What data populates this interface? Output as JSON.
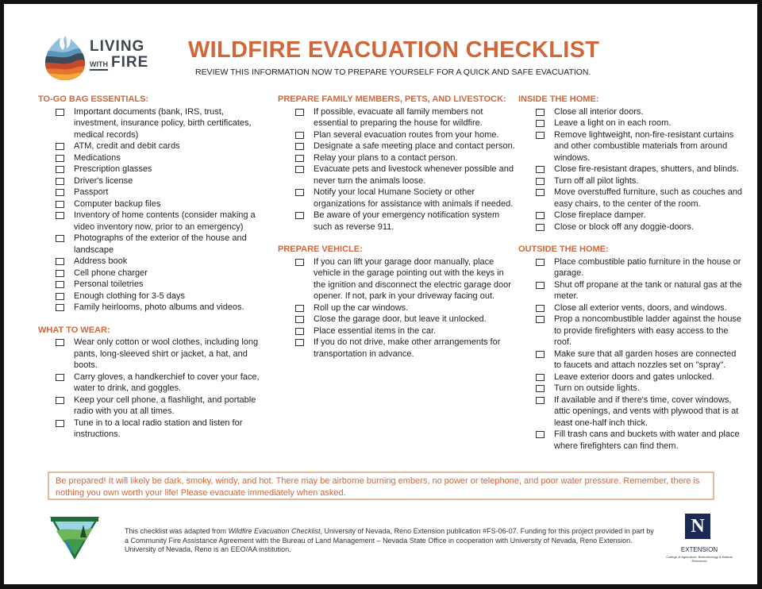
{
  "logo": {
    "line1": "LIVING",
    "with": "WITH",
    "fire": "FIRE"
  },
  "title": "WILDFIRE EVACUATION CHECKLIST",
  "subtitle": "REVIEW THIS INFORMATION NOW TO PREPARE YOURSELF FOR A QUICK AND SAFE EVACUATION.",
  "colors": {
    "accent": "#d0673a",
    "text": "#222222",
    "callout_border": "#e8b89a",
    "unr_navy": "#1b2a55"
  },
  "sections": {
    "to_go_bag": {
      "heading": "TO-GO BAG ESSENTIALS:",
      "items": [
        "Important documents (bank, IRS, trust, investment, insurance policy, birth certificates, medical records)",
        "ATM, credit and debit cards",
        "Medications",
        "Prescription glasses",
        "Driver's license",
        "Passport",
        "Computer backup files",
        "Inventory of home contents (consider making a video inventory now, prior to an emergency)",
        "Photographs of the exterior of the house and landscape",
        "Address book",
        "Cell phone charger",
        "Personal toiletries",
        "Enough clothing for 3-5 days",
        "Family heirlooms, photo albums and videos."
      ]
    },
    "what_to_wear": {
      "heading": "WHAT TO WEAR:",
      "items": [
        "Wear only cotton or wool clothes, including long pants, long-sleeved shirt or jacket, a hat, and boots.",
        "Carry gloves, a handkerchief to cover your face, water to drink, and goggles.",
        "Keep your cell phone, a flashlight, and portable radio with you at all times.",
        "Tune in to a local radio station and listen for instructions."
      ]
    },
    "family_pets": {
      "heading": "PREPARE FAMILY MEMBERS, PETS, AND LIVESTOCK:",
      "items": [
        "If possible, evacuate all family members not essential to preparing the house for wildfire.",
        "Plan several evacuation routes from your home.",
        "Designate a safe meeting place and contact person.",
        "Relay your plans to a contact person.",
        "Evacuate pets and livestock whenever possible and never turn the animals loose.",
        "Notify your local Humane Society or other organizations for assistance with animals if needed.",
        "Be aware of your emergency notification system such as reverse 911."
      ]
    },
    "vehicle": {
      "heading": "PREPARE VEHICLE:",
      "items": [
        "If you can lift your garage door manually, place vehicle in the garage pointing out with the keys in the ignition and disconnect the electric garage door opener. If not, park in your driveway facing out.",
        "Roll up the car windows.",
        "Close the garage door, but leave it unlocked.",
        "Place essential items in the car.",
        "If you do not drive, make other arrangements for transportation in advance."
      ]
    },
    "inside_home": {
      "heading": "INSIDE THE HOME:",
      "items": [
        "Close all interior doors.",
        "Leave a light on in each room.",
        "Remove lightweight, non-fire-resistant curtains and other combustible materials from around windows.",
        "Close fire-resistant drapes, shutters, and blinds.",
        "Turn off all pilot lights.",
        "Move overstuffed furniture, such as couches and easy chairs, to the center of the room.",
        "Close fireplace damper.",
        "Close or block off any doggie-doors."
      ]
    },
    "outside_home": {
      "heading": "OUTSIDE THE HOME:",
      "items": [
        "Place combustible patio furniture in the house or garage.",
        "Shut off propane at the tank or natural gas at the meter.",
        "Close all exterior vents, doors, and windows.",
        "Prop a noncombustible ladder against the house to provide firefighters with easy access to the roof.",
        "Make sure that all garden hoses are connected to faucets and attach nozzles set on \"spray\".",
        "Leave exterior doors and gates unlocked.",
        "Turn on outside lights.",
        "If available and if there's time, cover windows, attic openings, and vents with plywood that is at least one-half inch thick.",
        "Fill trash cans and buckets with water and place where firefighters can find them."
      ]
    }
  },
  "callout": "Be prepared! It will likely be dark, smoky, windy, and hot. There may be airborne burning embers, no power or telephone, and poor water pressure. Remember, there is nothing you own worth your life! Please evacuate immediately when asked.",
  "footer": {
    "credit_prefix": "This checklist was adapted from ",
    "credit_title": "Wildfire Evacuation Checklist",
    "credit_rest": ", University of Nevada, Reno Extension publication #FS-06-07. Funding for this project provided in part by a Community Fire Assistance Agreement with the Bureau of Land Management – Nevada State Office in cooperation with University of Nevada, Reno Extension. University of Nevada, Reno is an EEO/AA institution.",
    "unr_letter": "N",
    "extension_label": "EXTENSION",
    "extension_sub": "College of Agriculture, Biotechnology & Natural Resources"
  }
}
